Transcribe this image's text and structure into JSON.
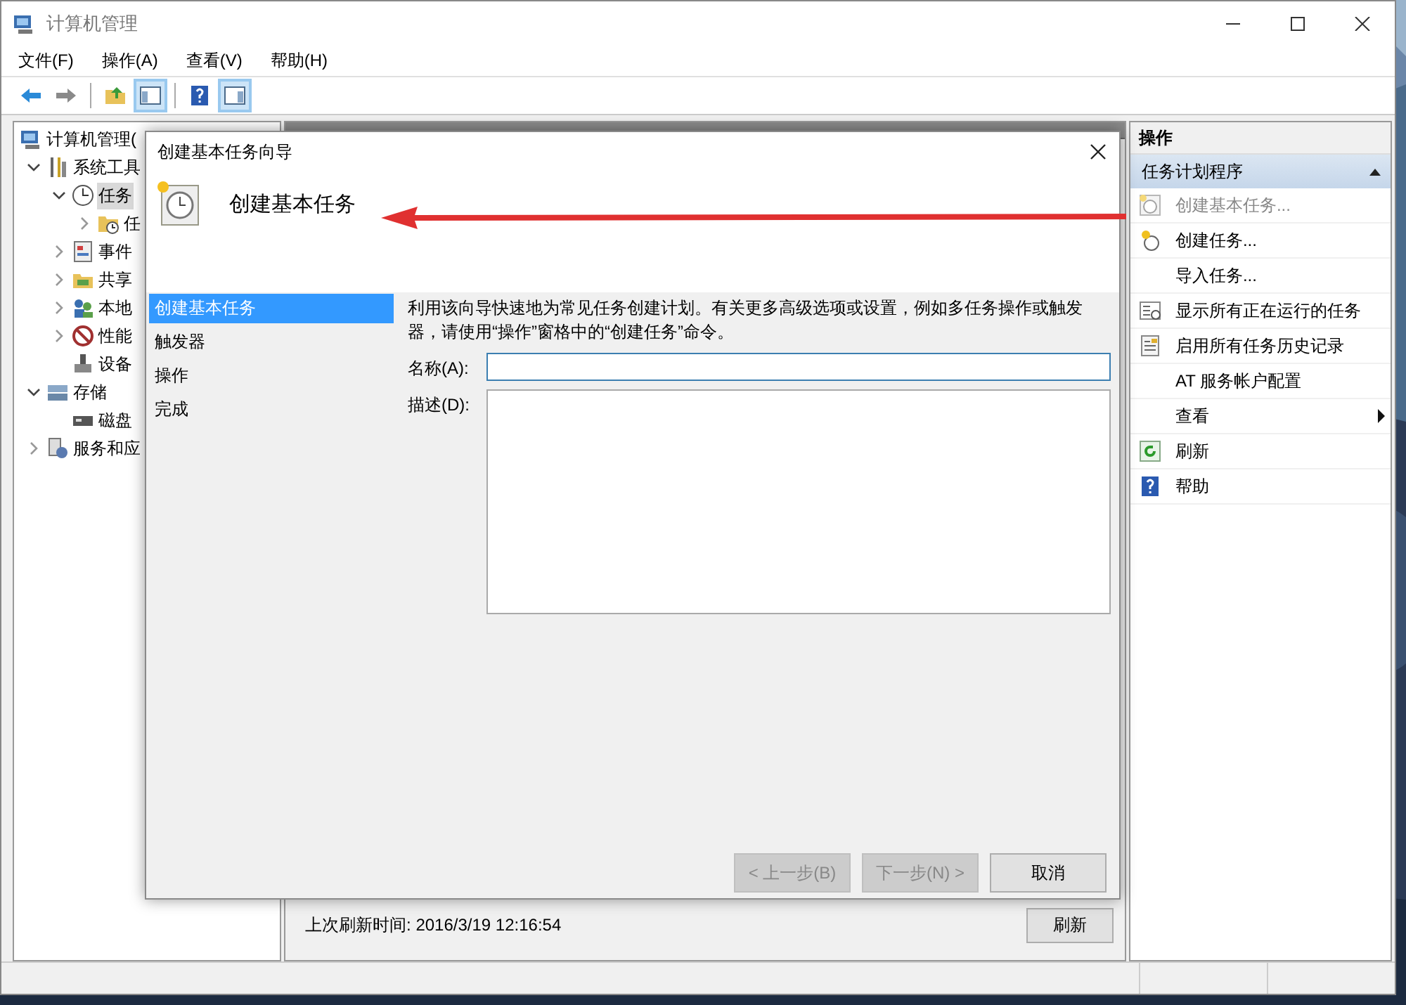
{
  "window": {
    "title": "计算机管理"
  },
  "menu": [
    {
      "label": "文件(F)"
    },
    {
      "label": "操作(A)"
    },
    {
      "label": "查看(V)"
    },
    {
      "label": "帮助(H)"
    }
  ],
  "toolbar": [
    {
      "pressed": false
    },
    {
      "pressed": false
    },
    {
      "pressed": false
    },
    {
      "pressed": true
    },
    {
      "pressed": false
    },
    {
      "pressed": true
    }
  ],
  "tree": [
    {
      "label": "计算机管理(",
      "selected": false,
      "children": [
        {
          "label": "系统工具",
          "expanded": true,
          "selected": false,
          "children": [
            {
              "label": "任务",
              "expanded": true,
              "selected": true,
              "children": [
                {
                  "label": "任",
                  "expanded": false,
                  "selected": false
                }
              ]
            },
            {
              "label": "事件",
              "expanded": false,
              "selected": false
            },
            {
              "label": "共享",
              "expanded": false,
              "selected": false
            },
            {
              "label": "本地",
              "expanded": false,
              "selected": false
            },
            {
              "label": "性能",
              "expanded": false,
              "selected": false
            },
            {
              "label": "设备",
              "selected": false
            }
          ]
        },
        {
          "label": "存储",
          "expanded": true,
          "selected": false,
          "children": [
            {
              "label": "磁盘",
              "selected": false
            }
          ]
        },
        {
          "label": "服务和应",
          "expanded": false,
          "selected": false
        }
      ]
    }
  ],
  "center": {
    "refresh_label": "上次刷新时间: 2016/3/19 12:16:54",
    "refresh_button": "刷新"
  },
  "actions": {
    "title": "操作",
    "section": {
      "label": "任务计划程序",
      "expanded": true
    },
    "items": [
      {
        "label": "创建基本任务...",
        "kind": "command",
        "disabled": true
      },
      {
        "label": "创建任务...",
        "kind": "command",
        "disabled": false
      },
      {
        "label": "导入任务...",
        "kind": "command",
        "disabled": false
      },
      {
        "label": "显示所有正在运行的任务",
        "kind": "command",
        "disabled": false
      },
      {
        "label": "启用所有任务历史记录",
        "kind": "command",
        "disabled": false
      },
      {
        "label": "AT 服务帐户配置",
        "kind": "command",
        "disabled": false
      },
      {
        "label": "查看",
        "kind": "submenu",
        "disabled": false
      },
      {
        "label": "刷新",
        "kind": "command",
        "disabled": false
      },
      {
        "label": "帮助",
        "kind": "command",
        "disabled": false
      }
    ]
  },
  "dialog": {
    "title": "创建基本任务向导",
    "heading": "创建基本任务",
    "steps": [
      {
        "label": "创建基本任务",
        "selected": true
      },
      {
        "label": "触发器",
        "selected": false
      },
      {
        "label": "操作",
        "selected": false
      },
      {
        "label": "完成",
        "selected": false
      }
    ],
    "description": "利用该向导快速地为常见任务创建计划。有关更多高级选项或设置，例如多任务操作或触发器，请使用“操作”窗格中的“创建任务”命令。",
    "name_field": {
      "label": "名称(A):",
      "focused": true
    },
    "description_field": {
      "label": "描述(D):",
      "focused": false
    },
    "buttons": [
      {
        "label": "< 上一步(B)",
        "disabled": true
      },
      {
        "label": "下一步(N) >",
        "disabled": true
      },
      {
        "label": "取消",
        "disabled": false
      }
    ]
  }
}
